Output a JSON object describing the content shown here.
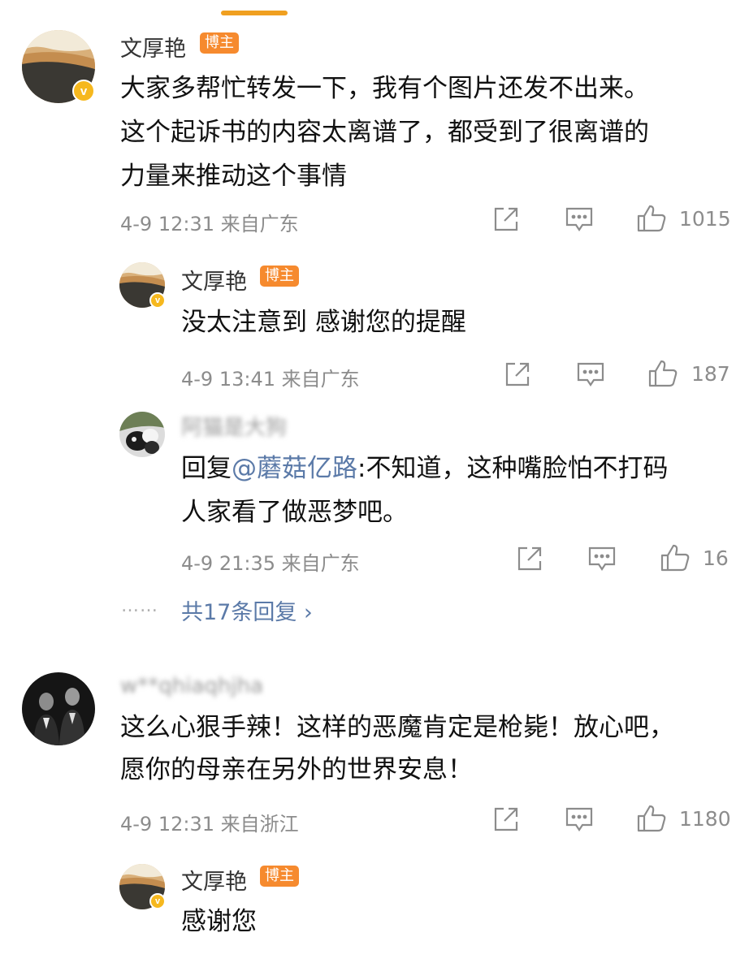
{
  "comments": [
    {
      "name": "文厚艳",
      "badge": "博主",
      "lines": [
        "大家多帮忙转发一下，我有个图片还发不出来。",
        "这个起诉书的内容太离谱了，都受到了很离谱的",
        "力量来推动这个事情"
      ],
      "time": "4-9 12:31",
      "location": "来自广东",
      "likes": "1015"
    },
    {
      "name": "文厚艳",
      "badge": "博主",
      "lines": [
        "没太注意到 感谢您的提醒"
      ],
      "time": "4-9 13:41",
      "location": "来自广东",
      "likes": "187"
    },
    {
      "name": "阿猫是大狗",
      "reply_prefix": "回复",
      "reply_mention": "@蘑菇亿路",
      "reply_line1": ":不知道，这种嘴脸怕不打码",
      "reply_line2": "人家看了做恶梦吧。",
      "time": "4-9 21:35",
      "location": "来自广东",
      "likes": "16"
    },
    {
      "name": "w**qhiaqhjha",
      "lines": [
        "这么心狠手辣！这样的恶魔肯定是枪毙！放心吧，",
        "愿你的母亲在另外的世界安息！"
      ],
      "time": "4-9 12:31",
      "location": "来自浙江",
      "likes": "1180"
    },
    {
      "name": "文厚艳",
      "badge": "博主",
      "lines": [
        "感谢您"
      ]
    }
  ],
  "more_replies": {
    "dots": "……",
    "label": "共17条回复",
    "chevron": "›"
  },
  "icons": {
    "share": "share-icon",
    "comment": "comment-icon",
    "like": "thumbs-up-icon",
    "verified": "verified-v-icon"
  },
  "colors": {
    "badge": "#f68a2e",
    "verified": "#f6b81e",
    "link": "#5b7aa8",
    "meta": "#8c8c8c"
  }
}
